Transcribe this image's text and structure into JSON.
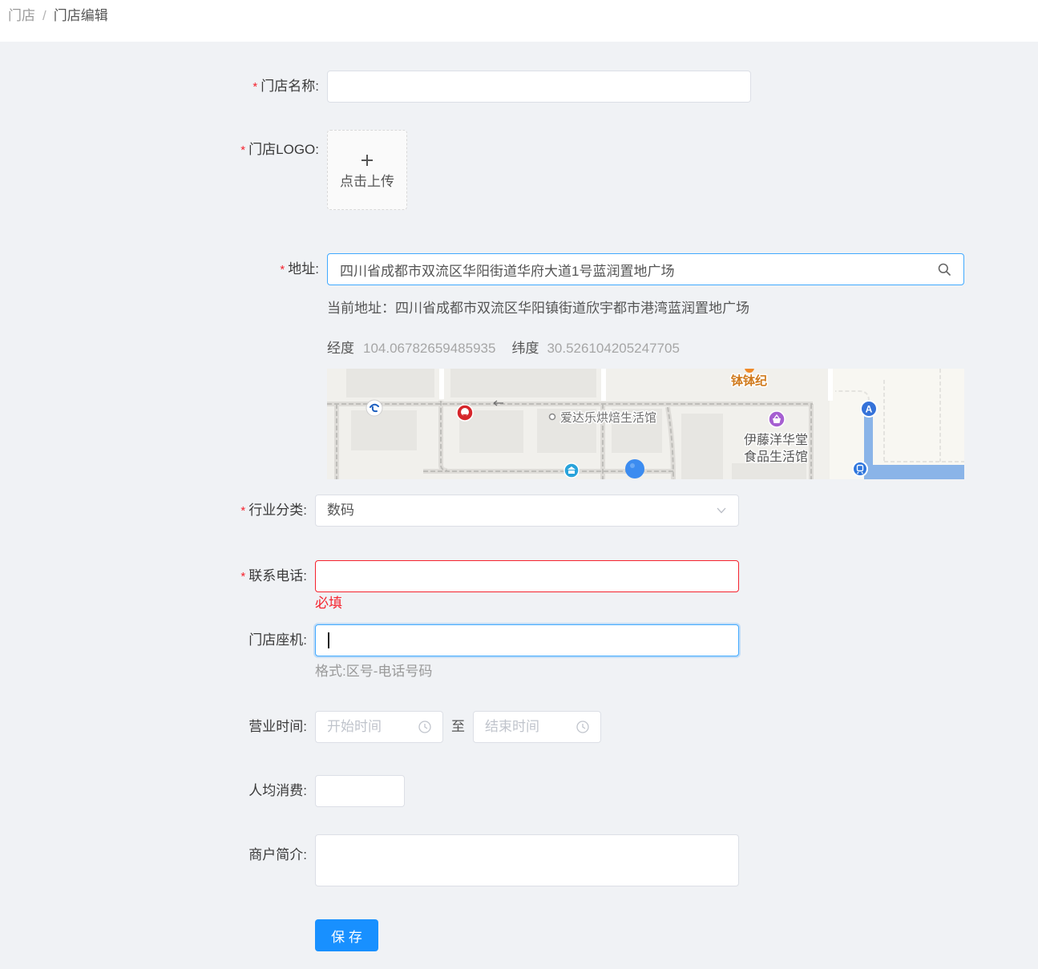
{
  "breadcrumb": {
    "items": [
      {
        "label": "门店"
      },
      {
        "label": "门店编辑"
      }
    ],
    "separator": "/"
  },
  "form": {
    "store_name": {
      "required_mark": "*",
      "label": "门店名称:",
      "value": ""
    },
    "logo": {
      "required_mark": "*",
      "label": "门店LOGO:",
      "upload_icon": "plus-icon",
      "upload_text": "点击上传"
    },
    "address": {
      "required_mark": "*",
      "label": "地址:",
      "value": "四川省成都市双流区华阳街道华府大道1号蓝润置地广场",
      "search_icon": "search-icon",
      "current_label": "当前地址：",
      "current_value": "四川省成都市双流区华阳镇街道欣宇都市港湾蓝润置地广场",
      "longitude_label": "经度",
      "longitude": "104.06782659485935",
      "latitude_label": "纬度",
      "latitude": "30.526104205247705"
    },
    "map": {
      "pois": [
        {
          "lines": [
            "钵钵纪"
          ]
        },
        {
          "lines": [
            "爱达乐烘焙生活馆"
          ]
        },
        {
          "lines": [
            "伊藤洋华堂",
            "食品生活馆"
          ]
        }
      ],
      "marker_letter": "A",
      "icons": [
        "china-telecom-icon",
        "kfc-icon",
        "one-way-arrow-icon",
        "shopping-icon",
        "bank-icon",
        "location-pin-icon",
        "transit-icon"
      ]
    },
    "industry": {
      "required_mark": "*",
      "label": "行业分类:",
      "value": "数码",
      "icon": "chevron-down-icon"
    },
    "phone": {
      "required_mark": "*",
      "label": "联系电话:",
      "value": "",
      "error": "必填"
    },
    "landline": {
      "label": "门店座机:",
      "value": "",
      "help": "格式:区号-电话号码"
    },
    "hours": {
      "label": "营业时间:",
      "start_placeholder": "开始时间",
      "separator": "至",
      "end_placeholder": "结束时间",
      "icon": "clock-icon"
    },
    "avg_spend": {
      "label": "人均消费:",
      "value": ""
    },
    "intro": {
      "label": "商户简介:",
      "value": ""
    },
    "save_label": "保 存"
  },
  "colors": {
    "page_bg": "#f0f2f5",
    "primary": "#1890ff",
    "focus_border": "#40a9ff",
    "error": "#f5222d",
    "required": "#f5222d",
    "poi_orange": "#d07a1c"
  }
}
